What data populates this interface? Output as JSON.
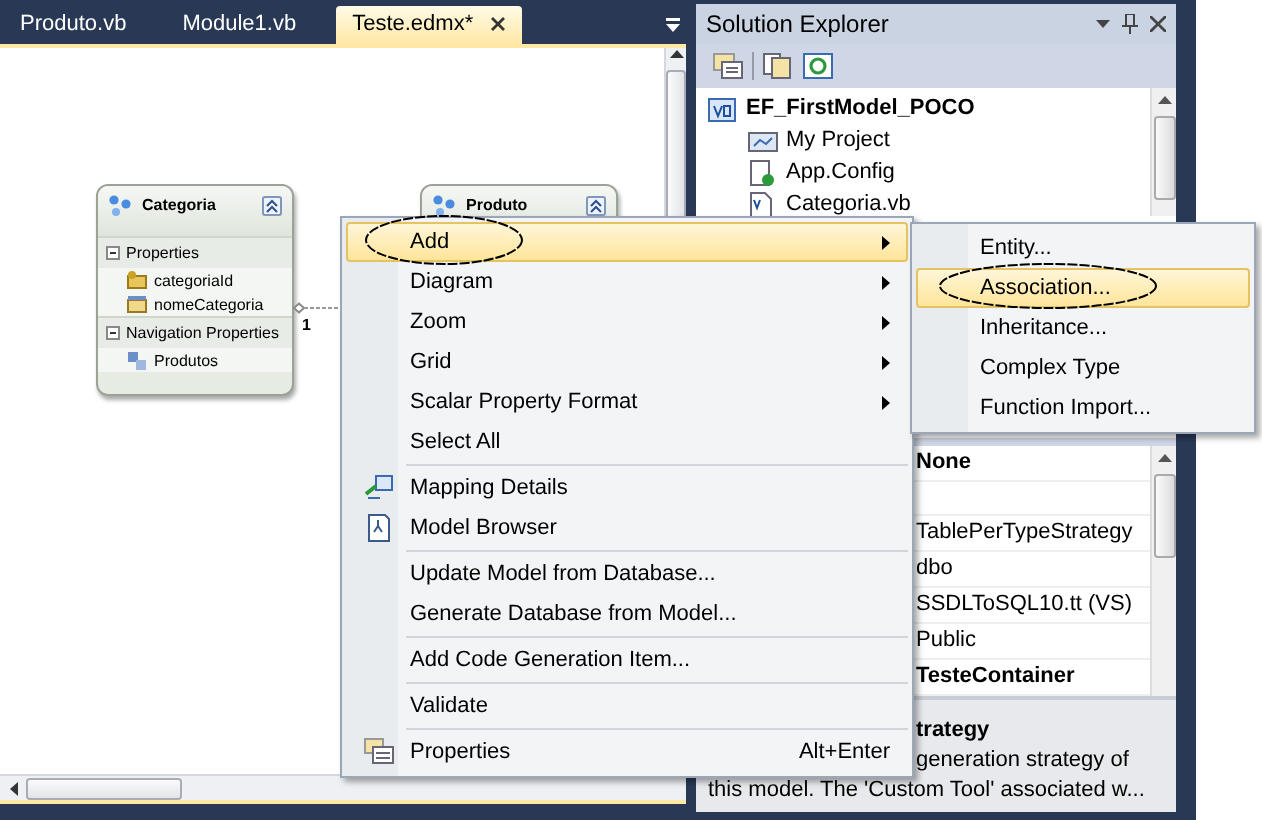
{
  "tabs": [
    {
      "label": "Produto.vb",
      "selected": false
    },
    {
      "label": "Module1.vb",
      "selected": false
    },
    {
      "label": "Teste.edmx*",
      "selected": true
    }
  ],
  "diagram": {
    "entities": [
      {
        "name": "Categoria",
        "sections": [
          {
            "title": "Properties",
            "expanded": true,
            "items": [
              {
                "label": "categoriaId",
                "kind": "key"
              },
              {
                "label": "nomeCategoria",
                "kind": "property"
              }
            ]
          },
          {
            "title": "Navigation Properties",
            "expanded": true,
            "items": [
              {
                "label": "Produtos",
                "kind": "navigation"
              }
            ]
          }
        ]
      },
      {
        "name": "Produto"
      }
    ],
    "association": {
      "multiplicity": "1"
    }
  },
  "solution_explorer": {
    "title": "Solution Explorer",
    "tree": [
      {
        "label": "EF_FirstModel_POCO",
        "kind": "project",
        "children": [
          {
            "label": "My Project",
            "kind": "myproject"
          },
          {
            "label": "App.Config",
            "kind": "config"
          },
          {
            "label": "Categoria.vb",
            "kind": "vbfile"
          }
        ]
      }
    ]
  },
  "properties": {
    "rows": [
      {
        "value": "None",
        "bold": true
      },
      {
        "value": "TablePerTypeStrategy",
        "bold": false
      },
      {
        "value": "dbo",
        "bold": false
      },
      {
        "value": "SSDLToSQL10.tt (VS)",
        "bold": false
      },
      {
        "value": "Public",
        "bold": false
      },
      {
        "value": "TesteContainer",
        "bold": true
      }
    ],
    "description_title": "trategy",
    "description_lines": [
      "generation strategy of",
      "this model. The 'Custom Tool' associated w..."
    ]
  },
  "context_menu": {
    "items": [
      {
        "label": "Add",
        "kind": "submenu",
        "selected": true
      },
      {
        "label": "Diagram",
        "kind": "submenu",
        "selected": false
      },
      {
        "label": "Zoom",
        "kind": "submenu",
        "selected": false
      },
      {
        "label": "Grid",
        "kind": "submenu",
        "selected": false
      },
      {
        "label": "Scalar Property Format",
        "kind": "submenu",
        "selected": false
      },
      {
        "label": "Select All",
        "kind": "command",
        "selected": false
      },
      {
        "kind": "separator"
      },
      {
        "label": "Mapping Details",
        "kind": "command",
        "selected": false
      },
      {
        "label": "Model Browser",
        "kind": "command",
        "selected": false
      },
      {
        "kind": "separator"
      },
      {
        "label": "Update Model from Database...",
        "kind": "command",
        "selected": false
      },
      {
        "label": "Generate Database from Model...",
        "kind": "command",
        "selected": false
      },
      {
        "kind": "separator"
      },
      {
        "label": "Add Code Generation Item...",
        "kind": "command",
        "selected": false
      },
      {
        "kind": "separator"
      },
      {
        "label": "Validate",
        "kind": "command",
        "selected": false
      },
      {
        "kind": "separator"
      },
      {
        "label": "Properties",
        "kind": "command",
        "shortcut": "Alt+Enter",
        "selected": false
      }
    ]
  },
  "submenu": {
    "items": [
      {
        "label": "Entity...",
        "selected": false
      },
      {
        "label": "Association...",
        "selected": true
      },
      {
        "label": "Inheritance...",
        "selected": false
      },
      {
        "label": "Complex Type",
        "selected": false
      },
      {
        "label": "Function Import...",
        "selected": false
      }
    ]
  }
}
